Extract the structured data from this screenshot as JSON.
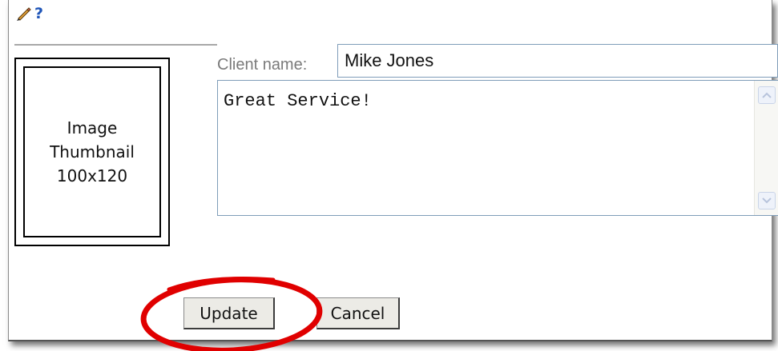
{
  "toolbar": {
    "edit_icon": "pencil-icon",
    "help_icon": "help-icon",
    "help_glyph": "?"
  },
  "thumbnail": {
    "lines": [
      "Image",
      "Thumbnail",
      "100x120"
    ]
  },
  "form": {
    "client_name_label": "Client name:",
    "client_name_value": "Mike Jones",
    "comment_value": "Great Service!"
  },
  "buttons": {
    "update_label": "Update",
    "cancel_label": "Cancel"
  },
  "colors": {
    "highlight": "#e00000",
    "help_icon": "#1f55b8",
    "field_border": "#7f9db9",
    "label_text": "#7a7a7a"
  }
}
